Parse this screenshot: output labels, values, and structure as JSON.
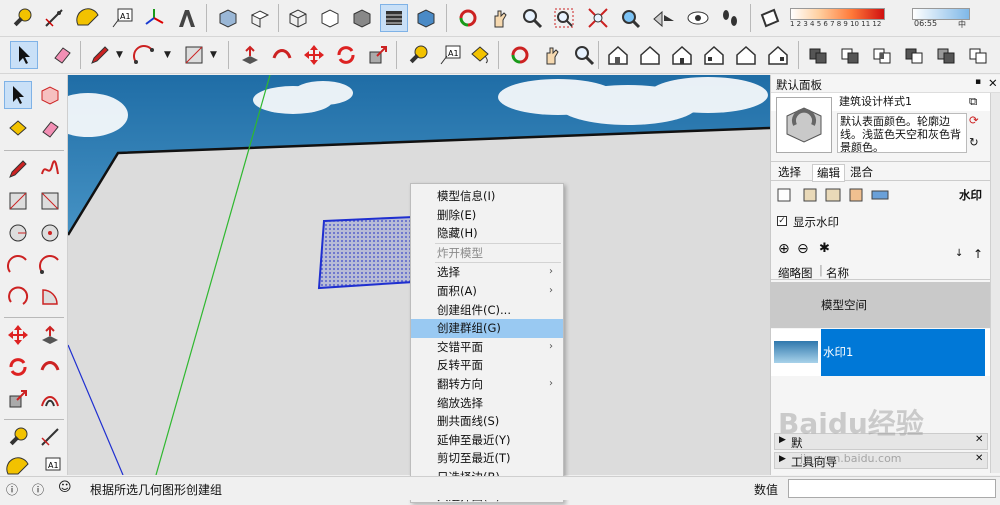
{
  "colors": {
    "accent": "#0078d7",
    "highlight": "#99c9f2",
    "selection_blue": "#1f2fd0",
    "axis_green": "#2fb82f"
  },
  "style_bar": {
    "scale": "1 2 3 4 5 6 7 8 9 10 11 12",
    "time": "06:55",
    "mid": "中"
  },
  "panel": {
    "title": "默认面板",
    "style_name": "建筑设计样式1",
    "style_desc": "默认表面颜色。轮廓边线。浅蓝色天空和灰色背景颜色。",
    "tabs": [
      "选择",
      "编辑",
      "混合"
    ],
    "section_label": "水印",
    "show_watermark": "显示水印",
    "col_thumb": "缩略图",
    "col_name": "名称",
    "row_model_space": "模型空间",
    "row_watermark": "水印1",
    "collapsed1": "默",
    "collapsed2": "工具向导"
  },
  "context_menu": {
    "items": [
      {
        "label": "模型信息(I)",
        "disabled": false,
        "arrow": false
      },
      {
        "label": "删除(E)",
        "disabled": false,
        "arrow": false
      },
      {
        "label": "隐藏(H)",
        "disabled": false,
        "arrow": false
      },
      {
        "label": "炸开模型",
        "disabled": true,
        "arrow": false
      },
      {
        "label": "选择",
        "disabled": false,
        "arrow": true
      },
      {
        "label": "面积(A)",
        "disabled": false,
        "arrow": true
      },
      {
        "label": "创建组件(C)...",
        "disabled": false,
        "arrow": false
      },
      {
        "label": "创建群组(G)",
        "disabled": false,
        "arrow": false,
        "highlight": true
      },
      {
        "label": "交错平面",
        "disabled": false,
        "arrow": true
      },
      {
        "label": "反转平面",
        "disabled": false,
        "arrow": false
      },
      {
        "label": "翻转方向",
        "disabled": false,
        "arrow": true
      },
      {
        "label": "缩放选择",
        "disabled": false,
        "arrow": false
      },
      {
        "label": "删共面线(S)",
        "disabled": false,
        "arrow": false
      },
      {
        "label": "延伸至最近(Y)",
        "disabled": false,
        "arrow": false
      },
      {
        "label": "剪切至最近(T)",
        "disabled": false,
        "arrow": false
      },
      {
        "label": "只选择边(B)",
        "disabled": false,
        "arrow": false
      },
      {
        "label": "只选择面(U)",
        "disabled": false,
        "arrow": false
      }
    ]
  },
  "status": {
    "message": "根据所选几何图形创建组",
    "value_label": "数值"
  },
  "watermark": {
    "brand": "Baidu经验",
    "url": "jingyan.baidu.com"
  }
}
